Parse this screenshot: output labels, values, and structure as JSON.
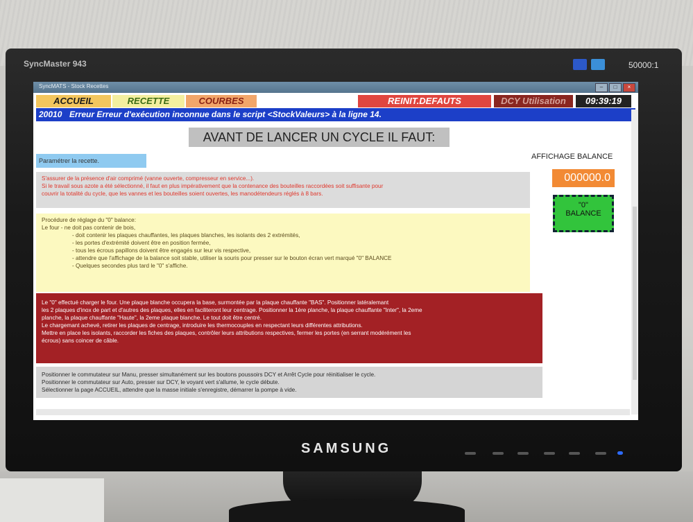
{
  "monitor": {
    "model": "SyncMaster 943",
    "contrast": "50000:1",
    "brand": "SAMSUNG"
  },
  "window": {
    "title": "SyncMATS - Stock Recettes"
  },
  "menu": {
    "accueil": "ACCUEIL",
    "recette": "RECETTE",
    "courbes": "COURBES",
    "reinit": "REINIT.DEFAUTS",
    "dcy": "DCY Utilisation",
    "time": "09:39:19"
  },
  "colors": {
    "accueil_bg": "#f3c65e",
    "recette_bg": "#f4ef9f",
    "courbes_bg": "#f2a66a",
    "reinit_bg": "#e0463f",
    "dcy_bg": "#8a2620",
    "time_bg": "#222222",
    "error_bar": "#1c3fc8"
  },
  "error": {
    "code": "20010",
    "message": "Erreur Erreur d'exécution inconnue dans le script <StockValeurs> à la ligne 14."
  },
  "heading": "AVANT DE LANCER UN CYCLE IL FAUT:",
  "step1": "Paramétrer la recette.",
  "step2": {
    "line1": "S'assurer de la présence d'air comprimé (vanne ouverte, compresseur en service...).",
    "line2": "Si le travail sous azote a été sélectionné, il faut en plus impérativement que la contenance des bouteilles raccordées soit suffisante pour",
    "line3": "couvrir la totalité du cycle, que les vannes et les bouteilles soient ouvertes, les manodétendeurs réglés à 8 bars."
  },
  "step3": {
    "line1": "Procédure de réglage du \"0\" balance:",
    "line2": "Le four  - ne doit pas contenir de bois,",
    "line3": "- doit contenir les plaques chauffantes, les plaques blanches, les isolants des 2 extrémités,",
    "line4": "- les portes d'extrémité doivent être en position fermée,",
    "line5": "- tous les écrous papillons doivent être engagés sur leur vis respective,",
    "line6": "- attendre que l'affichage de la balance soit stable, utiliser la souris pour presser sur le bouton écran vert marqué \"0\" BALANCE",
    "line7": "- Quelques secondes plus tard le \"0\" s'affiche."
  },
  "step4": {
    "line1": "Le \"0\" effectué charger le four. Une plaque blanche occupera la base, surmontée par la plaque chauffante \"BAS\". Positionner latéralemant",
    "line2": "les 2 plaques d'inox de part et d'autres des plaques, elles en faciliteront leur centrage. Positionner la 1ère planche, la plaque chauffante \"Inter\", la 2eme",
    "line3": "planche, la plaque chauffante \"Haute\", la 2eme plaque blanche. Le tout doit être centré.",
    "line4": "Le chargemant achevé, retirer les plaques de centrage, introduire les thermocouples en respectant leurs différentes attributions.",
    "line5": "Mettre en place les isolants, raccorder les fiches des plaques, contrôler leurs attributions respectives, fermer les portes (en serrant modérément les",
    "line6": "écrous) sans coincer de câble."
  },
  "step5": {
    "line1": "Positionner le commutateur sur Manu, presser simultanément sur les boutons poussoirs DCY et Arrêt Cycle pour réinitialiser le cycle.",
    "line2": "Positionner le commutateur sur Auto, presser sur DCY, le voyant vert s'allume, le cycle débute.",
    "line3": "Sélectionner la page ACCUEIL, attendre que la masse initiale s'enregistre, démarrer la pompe à vide."
  },
  "balance": {
    "title": "AFFICHAGE BALANCE",
    "value": "000000.0",
    "button_line1": "\"0\"",
    "button_line2": "BALANCE"
  }
}
